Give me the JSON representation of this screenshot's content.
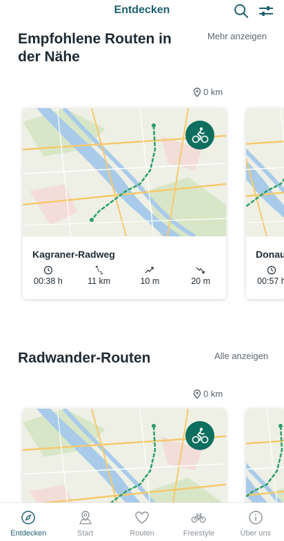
{
  "header": {
    "title": "Entdecken"
  },
  "sections": [
    {
      "title": "Empfohlene Routen in der Nähe",
      "link": "Mehr anzeigen",
      "distance": "0 km",
      "cards": [
        {
          "name": "Kagraner-Radweg",
          "duration": "00:38 h",
          "length": "11 km",
          "ascent": "10 m",
          "descent": "20 m"
        },
        {
          "name": "Donau",
          "duration": "00:57 h"
        }
      ]
    },
    {
      "title": "Radwander-Routen",
      "link": "Alle anzeigen",
      "distance": "0 km"
    }
  ],
  "tabs": [
    {
      "label": "Entdecken",
      "icon": "compass-icon",
      "active": true
    },
    {
      "label": "Start",
      "icon": "map-pin-icon"
    },
    {
      "label": "Routen",
      "icon": "heart-icon"
    },
    {
      "label": "Freestyle",
      "icon": "bicycle-icon"
    },
    {
      "label": "Über uns",
      "icon": "info-icon"
    }
  ],
  "colors": {
    "primary": "#1c5f6e",
    "badge": "#0f6f5e",
    "route": "#2a9d6a",
    "water": "#a9cbe9"
  }
}
